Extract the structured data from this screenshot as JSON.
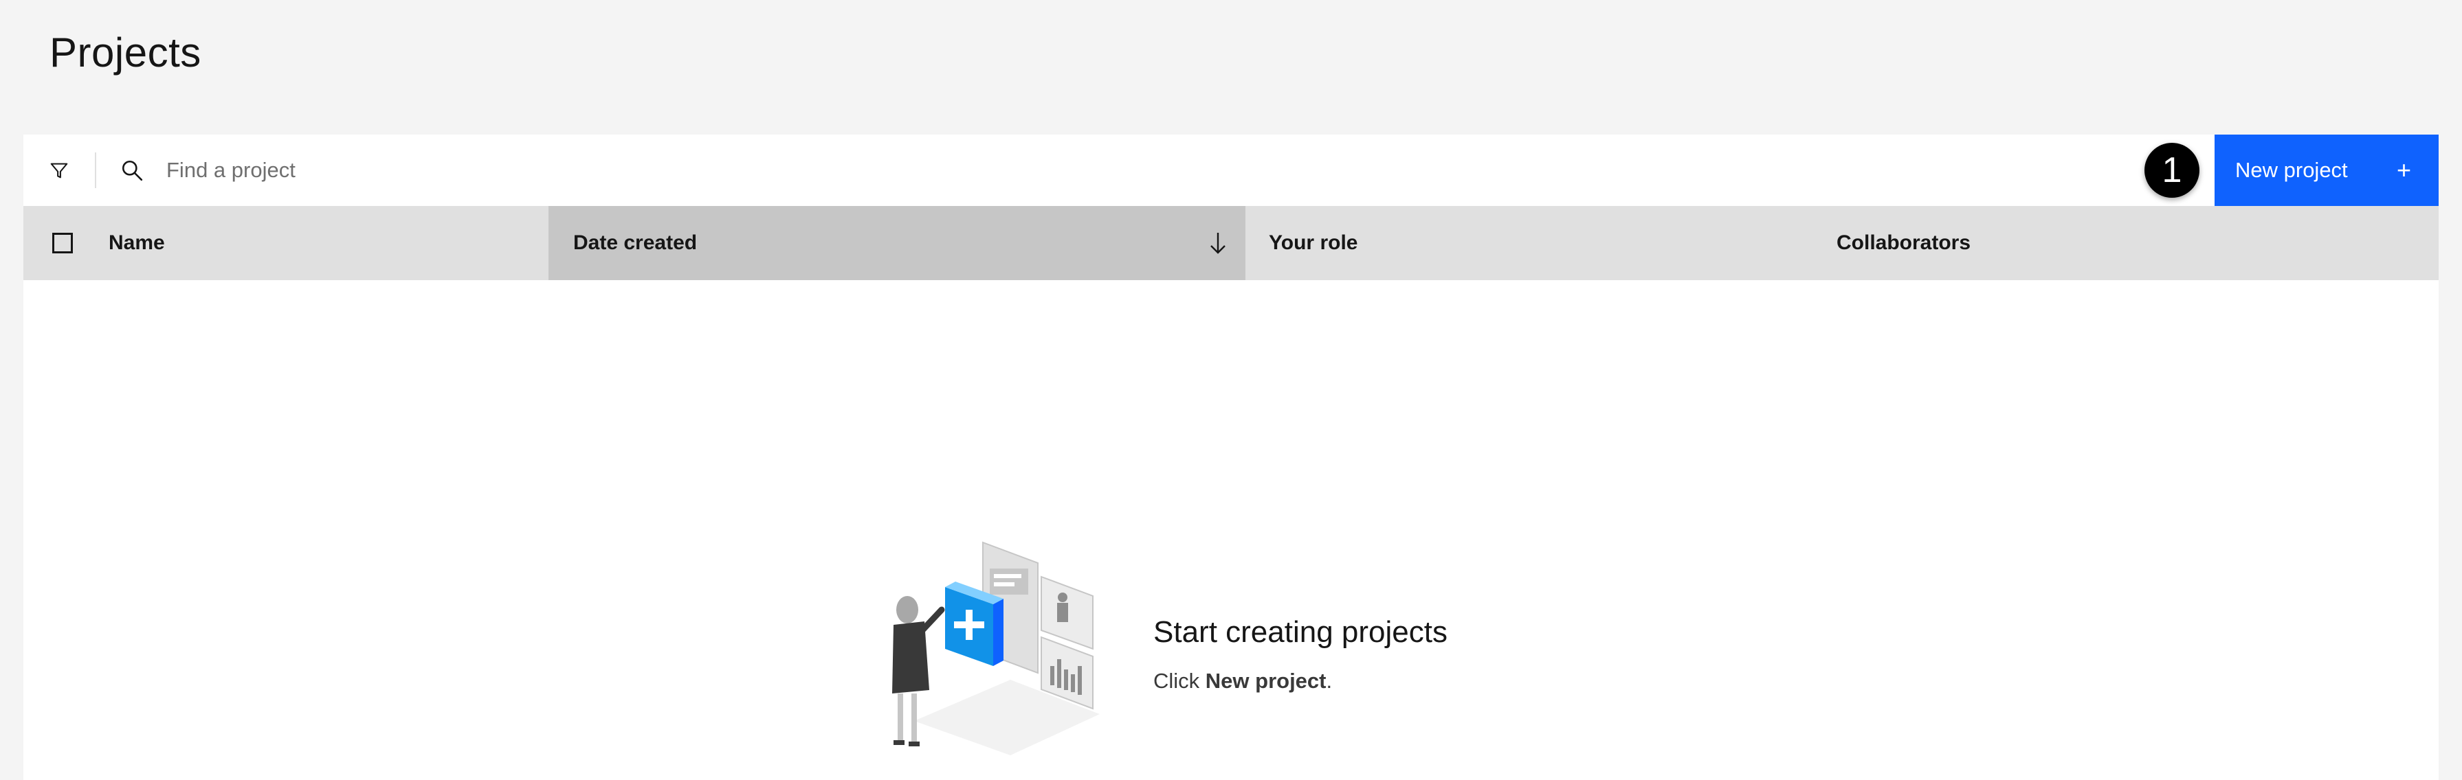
{
  "page": {
    "title": "Projects"
  },
  "toolbar": {
    "search_placeholder": "Find a project",
    "step_number": "1",
    "new_project_label": "New project",
    "new_project_plus": "+"
  },
  "table": {
    "columns": [
      {
        "label": "Name"
      },
      {
        "label": "Date created",
        "sorted": "descending"
      },
      {
        "label": "Your role"
      },
      {
        "label": "Collaborators"
      }
    ]
  },
  "empty_state": {
    "title": "Start creating projects",
    "subtitle_prefix": "Click ",
    "subtitle_bold": "New project",
    "subtitle_suffix": "."
  },
  "colors": {
    "background": "#f4f4f4",
    "primary_button": "#0f62fe",
    "table_header": "#e0e0e0",
    "sorted_header": "#c6c6c6"
  },
  "icons": {
    "filter": "filter-icon",
    "search": "search-icon",
    "sort": "arrow-down-icon",
    "plus": "plus-icon"
  }
}
